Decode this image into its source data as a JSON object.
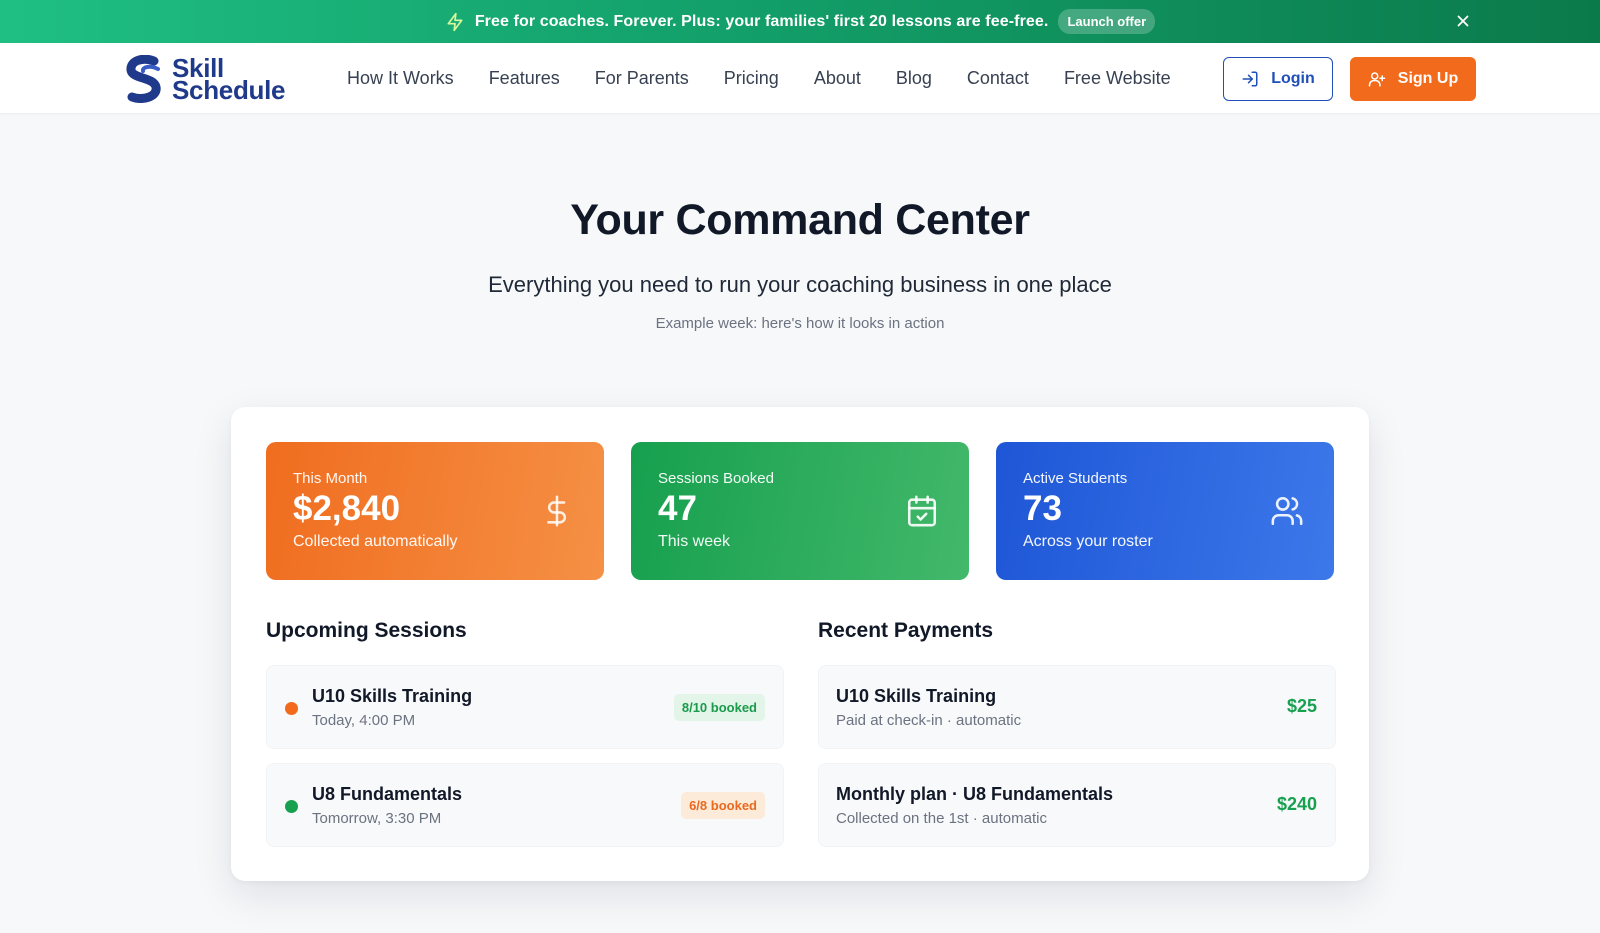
{
  "banner": {
    "text": "Free for coaches. Forever. Plus: your families' first 20 lessons are fee-free.",
    "badge": "Launch offer",
    "bolt_icon": "bolt-icon",
    "close_icon": "close-icon"
  },
  "nav": {
    "logo_line1": "Skill",
    "logo_line2": "Schedule",
    "links": [
      "How It Works",
      "Features",
      "For Parents",
      "Pricing",
      "About",
      "Blog",
      "Contact",
      "Free Website"
    ],
    "login_label": "Login",
    "signup_label": "Sign Up"
  },
  "hero": {
    "title": "Your Command Center",
    "subtitle": "Everything you need to run your coaching business in one place",
    "note": "Example week: here's how it looks in action"
  },
  "stats": [
    {
      "label": "This Month",
      "value": "$2,840",
      "sub": "Collected automatically",
      "icon": "dollar-icon",
      "color": "#f06d1f"
    },
    {
      "label": "Sessions Booked",
      "value": "47",
      "sub": "This week",
      "icon": "calendar-check-icon",
      "color": "#16a04e"
    },
    {
      "label": "Active Students",
      "value": "73",
      "sub": "Across your roster",
      "icon": "users-icon",
      "color": "#1e56d6"
    }
  ],
  "upcoming": {
    "title": "Upcoming Sessions",
    "items": [
      {
        "title": "U10 Skills Training",
        "when": "Today, 4:00 PM",
        "booked": "8/10 booked",
        "dot_color": "#f26a1b"
      },
      {
        "title": "U8 Fundamentals",
        "when": "Tomorrow, 3:30 PM",
        "booked": "6/8 booked",
        "dot_color": "#17a04e"
      }
    ]
  },
  "payments": {
    "title": "Recent Payments",
    "items": [
      {
        "title": "U10 Skills Training",
        "detail": "Paid at check-in · automatic",
        "amount": "$25"
      },
      {
        "title": "Monthly plan · U8 Fundamentals",
        "detail": "Collected on the 1st · automatic",
        "amount": "$240"
      }
    ]
  },
  "colors": {
    "accent_orange": "#f26a1b",
    "brand_blue": "#1f3a8a",
    "success_green": "#17a04e",
    "banner_green": "#13a06a"
  }
}
